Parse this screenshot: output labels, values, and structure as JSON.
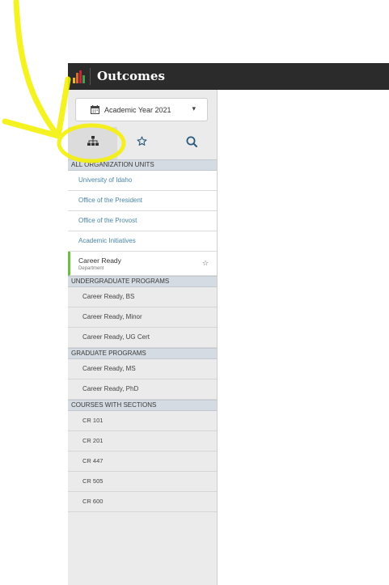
{
  "app": {
    "title": "Outcomes",
    "logo_colors": [
      "#f0b429",
      "#e2672b",
      "#c5283d",
      "#3fa34d"
    ]
  },
  "year_selector": {
    "label": "Academic Year 2021",
    "icon": "calendar-icon",
    "caret_icon": "chevron-down-icon"
  },
  "icon_tabs": [
    {
      "icon": "org-tree-icon",
      "active": true
    },
    {
      "icon": "star-icon",
      "active": false
    },
    {
      "icon": "search-icon",
      "active": false
    }
  ],
  "sections": {
    "org_units": "ALL ORGANIZATION UNITS",
    "undergrad": "UNDERGRADUATE PROGRAMS",
    "graduate": "GRADUATE PROGRAMS",
    "courses": "COURSES WITH SECTIONS"
  },
  "org_units": [
    "University of Idaho",
    "Office of the President",
    "Office of the Provost",
    "Academic Initiatives"
  ],
  "current_unit": {
    "name": "Career Ready",
    "type": "Department"
  },
  "undergrad_programs": [
    "Career Ready, BS",
    "Career Ready, Minor",
    "Career Ready, UG Cert"
  ],
  "graduate_programs": [
    "Career Ready, MS",
    "Career Ready, PhD"
  ],
  "courses": [
    "CR 101",
    "CR 201",
    "CR 447",
    "CR 505",
    "CR 600"
  ],
  "annotation": {
    "color": "#f5f10a"
  }
}
